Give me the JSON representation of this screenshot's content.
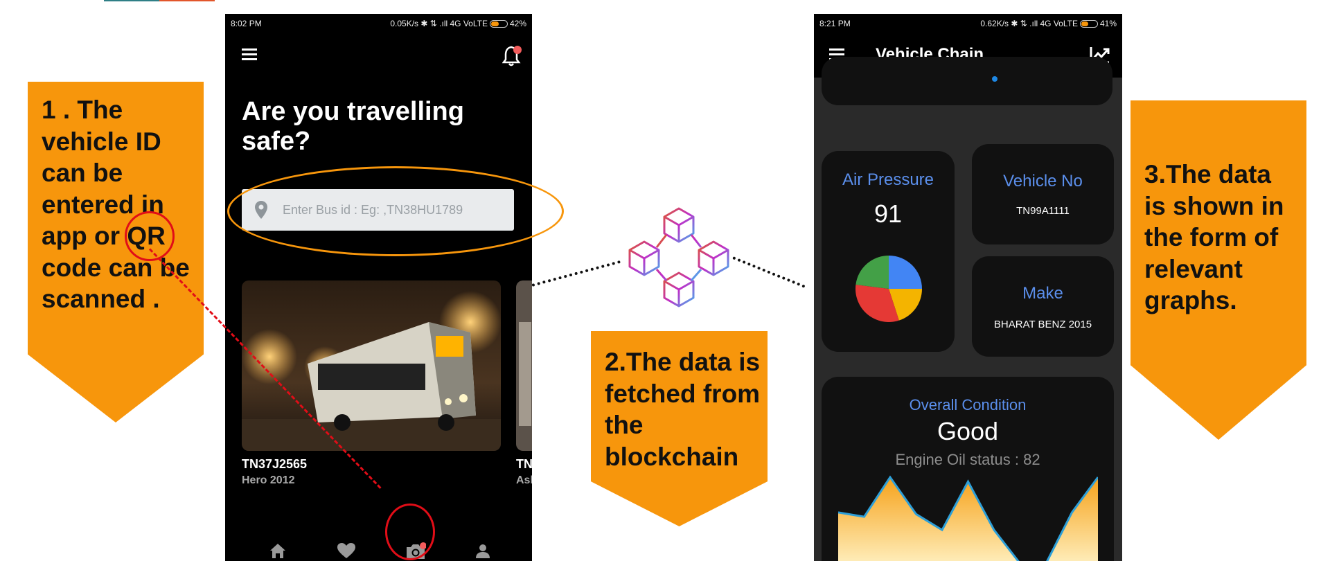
{
  "callouts": {
    "step1": "1 . The vehicle ID can be entered in app or QR code can be scanned .",
    "step2": "2.The data is fetched from the blockchain",
    "step3": "3.The data is shown in the form of relevant graphs."
  },
  "phone1": {
    "status": {
      "time": "8:02 PM",
      "network": "0.05K/s ✱ ⇅ .ıll 4G VoLTE",
      "battery": "42%"
    },
    "heading": "Are you travelling safe?",
    "search": {
      "placeholder": "Enter Bus id : Eg: ,TN38HU1789"
    },
    "cards": [
      {
        "title": "TN37J2565",
        "subtitle": "Hero 2012"
      },
      {
        "title": "TN",
        "subtitle": "Ash"
      }
    ],
    "nav": [
      {
        "icon": "home-icon"
      },
      {
        "icon": "heart-icon"
      },
      {
        "icon": "camera-icon"
      },
      {
        "icon": "person-icon"
      }
    ]
  },
  "phone2": {
    "status": {
      "time": "8:21 PM",
      "network": "0.62K/s ✱ ⇅ .ıll 4G VoLTE",
      "battery": "41%"
    },
    "app_title": "Vehicle Chain",
    "air_pressure": {
      "label": "Air Pressure",
      "value": "91"
    },
    "vehicle_no": {
      "label": "Vehicle No",
      "value": "TN99A1111"
    },
    "make": {
      "label": "Make",
      "value": "BHARAT BENZ 2015"
    },
    "condition": {
      "label": "Overall Condition",
      "value": "Good",
      "oil_status": "Engine Oil status : 82"
    },
    "pie_colors": [
      "#4285f4",
      "#f4b400",
      "#e53935",
      "#43a047"
    ],
    "pie_fractions": [
      0.25,
      0.2,
      0.32,
      0.23
    ],
    "area_values": [
      60,
      55,
      100,
      58,
      40,
      95,
      40,
      2,
      2,
      60,
      100
    ]
  },
  "colors": {
    "accent": "#f7960c",
    "highlight_red": "#e10d17",
    "label_blue": "#5b8fec"
  }
}
